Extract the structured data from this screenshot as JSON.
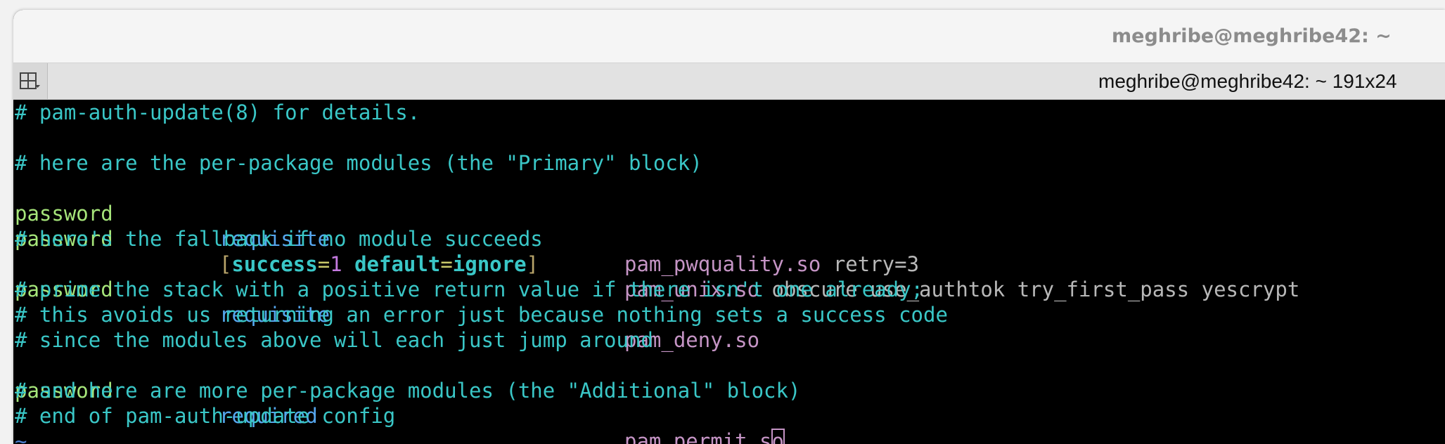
{
  "window": {
    "title": "meghribe@meghribe42: ~"
  },
  "tabbar": {
    "tab_title": "meghribe@meghribe42: ~ 191x24"
  },
  "terminal": {
    "l1": "# pam-auth-update(8) for details.",
    "l2": "# here are the per-package modules (the \"Primary\" block)",
    "l3": {
      "type": "password",
      "control": "requisite",
      "module": "pam_pwquality.so",
      "args": " retry=3"
    },
    "l4": {
      "type": "password",
      "b_open": "[",
      "success_key": "success",
      "eq1": "=",
      "success_val": "1",
      "default_key": "default",
      "eq2": "=",
      "default_val": "ignore",
      "b_close": "]",
      "module": "pam_unix.so",
      "args": " obscure use_authtok try_first_pass yescrypt"
    },
    "l5": "# here's the fallback if no module succeeds",
    "l6": {
      "type": "password",
      "control": "requisite",
      "module": "pam_deny.so"
    },
    "l7": "# prime the stack with a positive return value if there isn't one already;",
    "l8": "# this avoids us returning an error just because nothing sets a success code",
    "l9": "# since the modules above will each just jump around",
    "l10": {
      "type": "password",
      "control": "required",
      "module_before_cursor": "pam_permit.s",
      "cursor_char": "o"
    },
    "l11": "# and here are more per-package modules (the \"Additional\" block)",
    "l12": "# end of pam-auth-update config",
    "l13": "~"
  }
}
